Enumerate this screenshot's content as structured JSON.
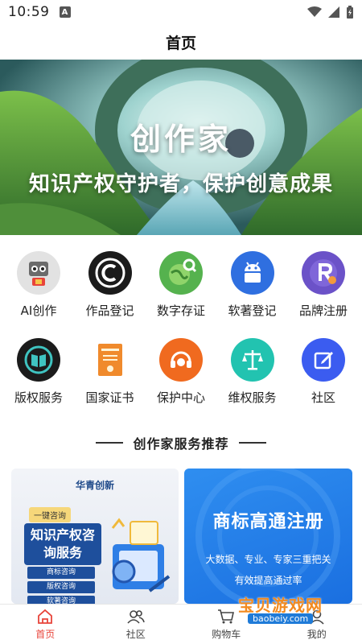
{
  "status": {
    "time": "10:59",
    "a_glyph": "A"
  },
  "header": {
    "title": "首页"
  },
  "banner": {
    "title": "创作家",
    "subtitle": "知识产权守护者，保护创意成果"
  },
  "grid": [
    [
      {
        "label": "AI创作",
        "icon": "robot-icon",
        "color": "#d9d9d9"
      },
      {
        "label": "作品登记",
        "icon": "copyright-icon",
        "color": "#1b1b1b"
      },
      {
        "label": "数字存证",
        "icon": "globe-search-icon",
        "color": "#4caf50"
      },
      {
        "label": "软著登记",
        "icon": "android-icon",
        "color": "#2f6fe0"
      },
      {
        "label": "品牌注册",
        "icon": "registered-r-icon",
        "color": "#6b52c8"
      }
    ],
    [
      {
        "label": "版权服务",
        "icon": "book-icon",
        "color": "#1b1b1b"
      },
      {
        "label": "国家证书",
        "icon": "certificate-icon",
        "color": "#f08a2c"
      },
      {
        "label": "保护中心",
        "icon": "headset-icon",
        "color": "#f06a1f"
      },
      {
        "label": "维权服务",
        "icon": "scales-icon",
        "color": "#22c3b0"
      },
      {
        "label": "社区",
        "icon": "edit-icon",
        "color": "#3b5cf0"
      }
    ]
  ],
  "section": {
    "title": "创作家服务推荐"
  },
  "cards": {
    "left": {
      "brand": "华青创新",
      "tag": "一键咨询",
      "heading": "知识产权咨询服务",
      "pills": [
        "商标咨询",
        "版权咨询",
        "软著咨询"
      ]
    },
    "right": {
      "title": "商标高通注册",
      "subtitle": "大数据、专业、专家三重把关",
      "subtitle2": "有效提高通过率"
    }
  },
  "tabs": [
    {
      "label": "首页",
      "icon": "home-icon",
      "active": true
    },
    {
      "label": "社区",
      "icon": "community-icon",
      "active": false
    },
    {
      "label": "购物车",
      "icon": "cart-icon",
      "active": false
    },
    {
      "label": "我的",
      "icon": "profile-icon",
      "active": false
    }
  ],
  "watermark": {
    "text": "宝贝游戏网",
    "url": "baobeiy.com"
  },
  "colors": {
    "accent": "#e8443a",
    "brand_blue": "#1e4f9c"
  }
}
